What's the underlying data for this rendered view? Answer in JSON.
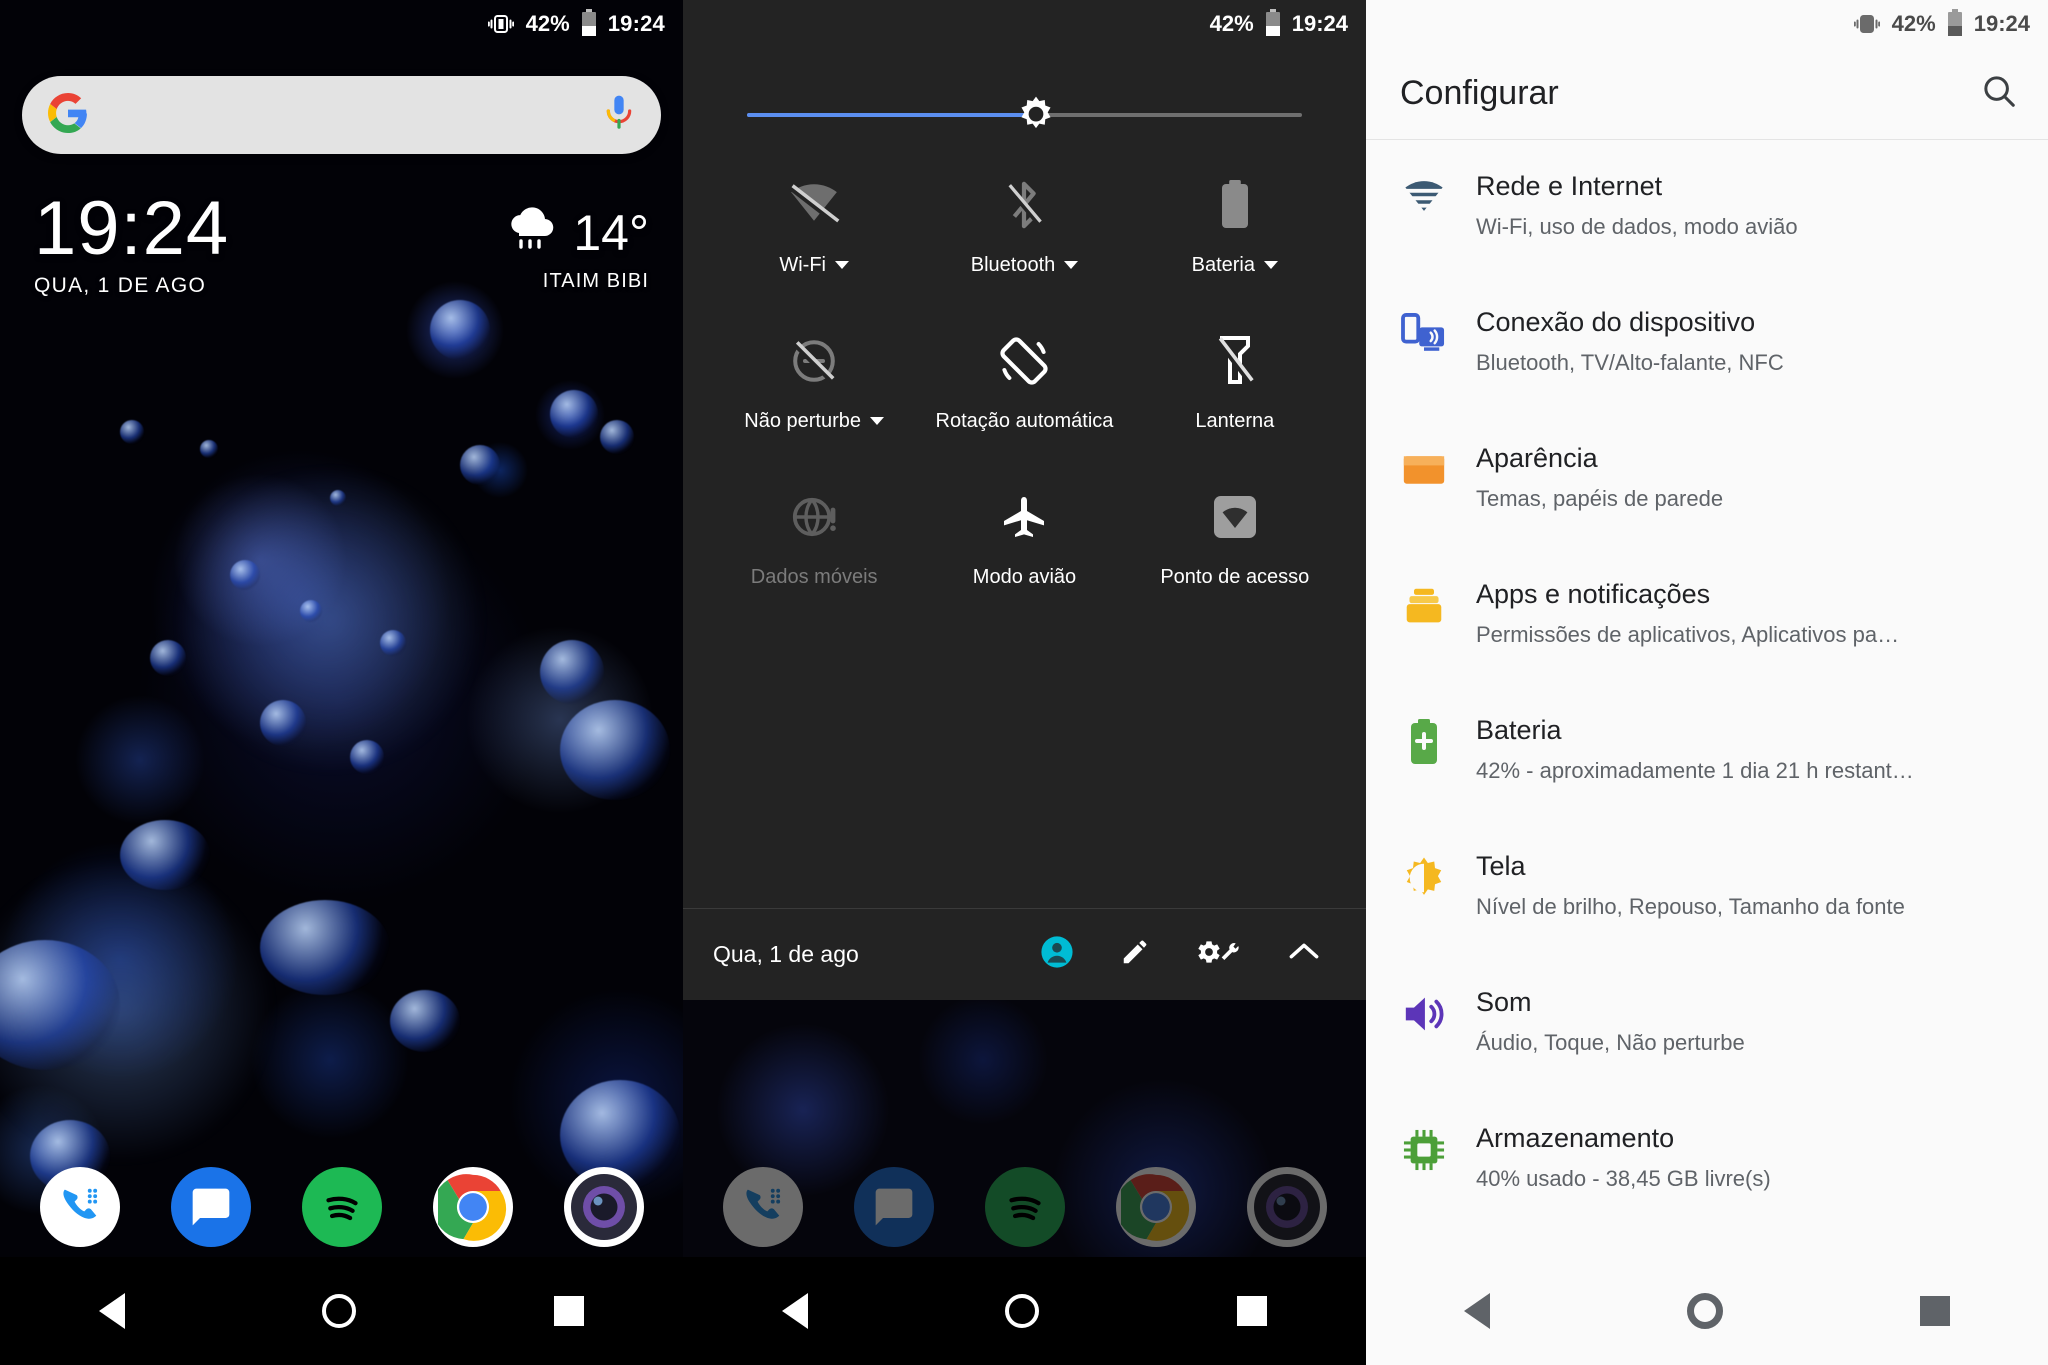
{
  "statusbar": {
    "battery_percent": "42%",
    "time": "19:24",
    "vibrate_icon": "vibrate-icon",
    "battery_icon": "battery-icon"
  },
  "home": {
    "search": {
      "placeholder": "",
      "value": "",
      "google_icon": "google-g-icon",
      "mic_icon": "google-mic-icon"
    },
    "clock": {
      "time": "19:24",
      "date": "QUA, 1 DE AGO"
    },
    "weather": {
      "temperature": "14°",
      "location": "ITAIM BIBI",
      "icon": "rain-cloud-icon"
    },
    "dock": [
      {
        "name": "phone",
        "label": "Telefone"
      },
      {
        "name": "messages",
        "label": "Mensagens"
      },
      {
        "name": "spotify",
        "label": "Spotify"
      },
      {
        "name": "chrome",
        "label": "Chrome"
      },
      {
        "name": "camera",
        "label": "Câmera"
      }
    ],
    "navbar": [
      {
        "name": "back",
        "label": "Voltar"
      },
      {
        "name": "home",
        "label": "Início"
      },
      {
        "name": "recents",
        "label": "Recentes"
      }
    ]
  },
  "quicksettings": {
    "brightness": {
      "value": 52,
      "icon": "brightness-sun-icon"
    },
    "tiles": [
      {
        "label": "Wi-Fi",
        "icon": "wifi-off-icon",
        "has_caret": true,
        "enabled": false
      },
      {
        "label": "Bluetooth",
        "icon": "bluetooth-off-icon",
        "has_caret": true,
        "enabled": false
      },
      {
        "label": "Bateria",
        "icon": "battery-icon",
        "has_caret": true,
        "enabled": false
      },
      {
        "label": "Não perturbe",
        "icon": "do-not-disturb-off-icon",
        "has_caret": true,
        "enabled": false
      },
      {
        "label": "Rotação automática",
        "icon": "auto-rotate-icon",
        "has_caret": false,
        "enabled": true
      },
      {
        "label": "Lanterna",
        "icon": "flashlight-off-icon",
        "has_caret": false,
        "enabled": false
      },
      {
        "label": "Dados móveis",
        "icon": "mobile-data-off-icon",
        "has_caret": false,
        "enabled": false
      },
      {
        "label": "Modo avião",
        "icon": "airplane-mode-icon",
        "has_caret": false,
        "enabled": true
      },
      {
        "label": "Ponto de acesso",
        "icon": "hotspot-icon",
        "has_caret": false,
        "enabled": true
      }
    ],
    "footer": {
      "date": "Qua, 1 de ago",
      "icons": [
        {
          "name": "user-account-icon",
          "color": "#00bcd4"
        },
        {
          "name": "edit-pencil-icon",
          "color": "#ffffff"
        },
        {
          "name": "settings-gear-wrench-icon",
          "color": "#ffffff"
        },
        {
          "name": "collapse-chevron-up-icon",
          "color": "#ffffff"
        }
      ]
    }
  },
  "settings": {
    "title": "Configurar",
    "search_icon": "search-icon",
    "items": [
      {
        "title": "Rede e Internet",
        "subtitle": "Wi-Fi, uso de dados, modo avião",
        "icon": "wifi-icon",
        "color": "#3c5a73"
      },
      {
        "title": "Conexão do dispositivo",
        "subtitle": "Bluetooth, TV/Alto-falante, NFC",
        "icon": "device-connection-icon",
        "color": "#3f62d0"
      },
      {
        "title": "Aparência",
        "subtitle": "Temas, papéis de parede",
        "icon": "appearance-icon",
        "color": "#f2922c"
      },
      {
        "title": "Apps e notificações",
        "subtitle": "Permissões de aplicativos, Aplicativos pa…",
        "icon": "apps-icon",
        "color": "#f5b820"
      },
      {
        "title": "Bateria",
        "subtitle": "42% - aproximadamente 1 dia 21 h restant…",
        "icon": "battery-plus-icon",
        "color": "#58a948"
      },
      {
        "title": "Tela",
        "subtitle": "Nível de brilho, Repouso, Tamanho da fonte",
        "icon": "display-brightness-icon",
        "color": "#f5b820"
      },
      {
        "title": "Som",
        "subtitle": "Áudio, Toque, Não perturbe",
        "icon": "sound-icon",
        "color": "#5c35b8"
      },
      {
        "title": "Armazenamento",
        "subtitle": "40% usado - 38,45 GB livre(s)",
        "icon": "storage-chip-icon",
        "color": "#4c9f38"
      }
    ],
    "navbar": [
      {
        "name": "back",
        "label": "Voltar"
      },
      {
        "name": "home",
        "label": "Início"
      },
      {
        "name": "recents",
        "label": "Recentes"
      }
    ]
  }
}
